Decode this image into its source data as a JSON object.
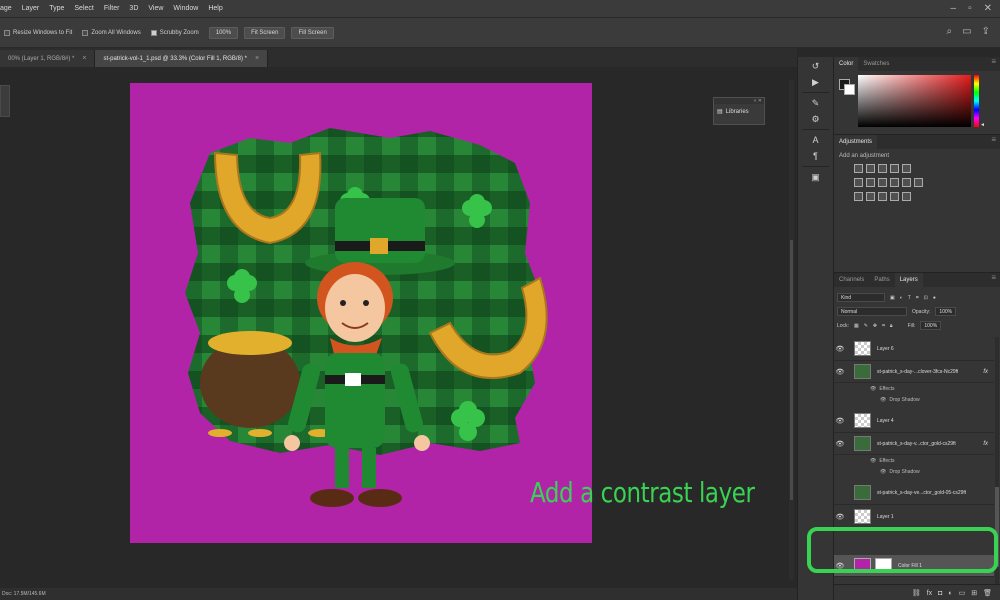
{
  "menubar": {
    "items": [
      "age",
      "Layer",
      "Type",
      "Select",
      "Filter",
      "3D",
      "View",
      "Window",
      "Help"
    ]
  },
  "window_controls": {
    "minimize": "–",
    "restore": "▫",
    "close": "✕"
  },
  "options_bar": {
    "resize_windows": "Resize Windows to Fit",
    "zoom_all": "Zoom All Windows",
    "scrubby_zoom": "Scrubby Zoom",
    "zoom_percent": "100%",
    "fit_screen": "Fit Screen",
    "fill_screen": "Fill Screen"
  },
  "tabs": [
    {
      "label": "00% (Layer 1, RGB/8#) *",
      "active": false
    },
    {
      "label": "st-patrick-vol-1_1.psd @ 33.3% (Color Fill 1, RGB/8) *",
      "active": true
    }
  ],
  "libraries_panel": {
    "label": "Libraries"
  },
  "status_bar": {
    "doc": "Doc: 17.5M/145.6M"
  },
  "color_panel": {
    "tabs": [
      "Color",
      "Swatches"
    ]
  },
  "adjustments_panel": {
    "tab": "Adjustments",
    "label": "Add an adjustment"
  },
  "layers_panel": {
    "tabs": [
      "Channels",
      "Paths",
      "Layers"
    ],
    "kind": "Kind",
    "blend_mode": "Normal",
    "opacity_label": "Opacity:",
    "opacity_value": "100%",
    "lock_label": "Lock:",
    "fill_label": "Fill:",
    "fill_value": "100%",
    "layers": [
      {
        "name": "Layer 6",
        "fx": ""
      },
      {
        "name": "st-patrick_s-day-...clover-3fcs-Nc29ft",
        "fx": "fx"
      },
      {
        "name": "Layer 4",
        "fx": ""
      },
      {
        "name": "st-patrick_s-day-v...ctor_gold-cs29ft",
        "fx": "fx"
      },
      {
        "name": "st-patrick_s-day-ve...ctor_gold-05-cs29ft",
        "fx": ""
      },
      {
        "name": "Layer 1",
        "fx": ""
      },
      {
        "name": "Color Fill 1",
        "fx": ""
      }
    ],
    "effects_label": "Effects",
    "drop_shadow_label": "Drop Shadow"
  },
  "annotation": {
    "text": "Add a contrast layer"
  },
  "colors": {
    "canvas_fill": "#b124a8",
    "highlight_green": "#39d353",
    "ui_dark": "#353535"
  }
}
